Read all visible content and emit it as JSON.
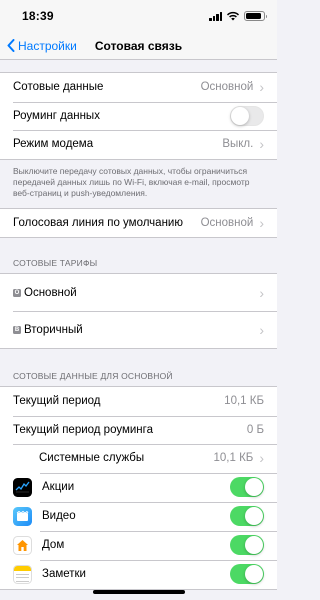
{
  "status_bar": {
    "time": "18:39"
  },
  "nav": {
    "back_label": "Настройки",
    "title": "Сотовая связь"
  },
  "group1": {
    "cellular_data": {
      "label": "Сотовые данные",
      "value": "Основной"
    },
    "roaming": {
      "label": "Роуминг данных",
      "enabled": false
    },
    "modem": {
      "label": "Режим модема",
      "value": "Выкл."
    }
  },
  "note": "Выключите передачу сотовых данных, чтобы ограничиться передачей данных лишь по Wi-Fi, включая e-mail, просмотр веб-страниц и push-уведомления.",
  "voice_line": {
    "label": "Голосовая линия по умолчанию",
    "value": "Основной"
  },
  "plans": {
    "header": "Сотовые тарифы",
    "items": [
      {
        "badge": "O",
        "label": "Основной"
      },
      {
        "badge": "В",
        "label": "Вторичный"
      }
    ]
  },
  "usage": {
    "header": "Сотовые данные для Основной",
    "current_period": {
      "label": "Текущий период",
      "value": "10,1 КБ"
    },
    "roaming_period": {
      "label": "Текущий период роуминга",
      "value": "0 Б"
    },
    "system_services": {
      "label": "Системные службы",
      "value": "10,1 КБ"
    },
    "apps": [
      {
        "label": "Акции",
        "icon": "stocks-icon",
        "enabled": true
      },
      {
        "label": "Видео",
        "icon": "videos-icon",
        "enabled": true
      },
      {
        "label": "Дом",
        "icon": "home-icon",
        "enabled": true
      },
      {
        "label": "Заметки",
        "icon": "notes-icon",
        "enabled": true
      }
    ]
  },
  "colors": {
    "accent": "#007aff",
    "toggle_on": "#4cd964",
    "secondary_text": "#8e8e93"
  }
}
